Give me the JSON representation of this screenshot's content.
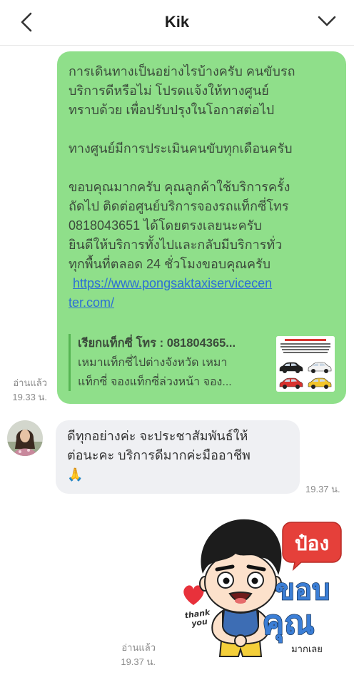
{
  "header": {
    "title": "Kik",
    "back_icon": "chevron-left-icon",
    "menu_icon": "chevron-down-icon"
  },
  "colors": {
    "outgoing_bubble": "#8fdf8a",
    "incoming_bubble": "#eff0f3",
    "link": "#2d6fd4",
    "preview_bar": "#56b553",
    "muted_text": "#8a8a8a"
  },
  "outgoing_message": {
    "paragraphs": [
      [
        "การเดินทางเป็นอย่างไรบ้างครับ คนขับรถ",
        "บริการดีหรือไม่ โปรดแจ้งให้ทางศูนย์",
        "ทราบด้วย เพื่อปรับปรุงในโอกาสต่อไป"
      ],
      [
        "ทางศูนย์มีการประเมินคนขับทุกเดือนครับ"
      ],
      [
        "ขอบคุณมากครับ คุณลูกค้าใช้บริการครั้ง",
        "ถัดไป ติดต่อศูนย์บริการจองรถแท็กซี่โทร",
        "0818043651 ได้โดยตรงเลยนะครับ",
        "ยินดีให้บริการทั้งไปและกลับมีบริการทั่ว",
        "ทุกพื้นที่ตลอด 24 ชั่วโมงขอบคุณครับ"
      ]
    ],
    "link_lines": [
      "https://www.pongsaktaxiservicecen",
      "ter.com/"
    ],
    "link_preview": {
      "title": "เรียกแท็กซี่ โทร : 081804365...",
      "description_lines": [
        "เหมาแท็กซี่ไปต่างจังหวัด เหมา",
        "แท็กซี่ จองแท็กซี่ล่วงหน้า จอง..."
      ]
    },
    "read_status": "อ่านแล้ว",
    "time": "19.33 น."
  },
  "incoming_message": {
    "lines": [
      "ดีทุกอย่างค่ะ จะประชาสัมพันธ์ให้",
      "ต่อนะคะ บริการดีมากค่ะมืออาชีพ",
      "🙏"
    ],
    "time": "19.37 น."
  },
  "sticker_message": {
    "sticker": {
      "badge": "ป๋อง",
      "text_top": "ขอบ",
      "text_middle": "คุณ",
      "text_bottom": "มากเลย",
      "heart_text": [
        "thank",
        "you"
      ]
    },
    "read_status": "อ่านแล้ว",
    "time": "19.37 น."
  }
}
